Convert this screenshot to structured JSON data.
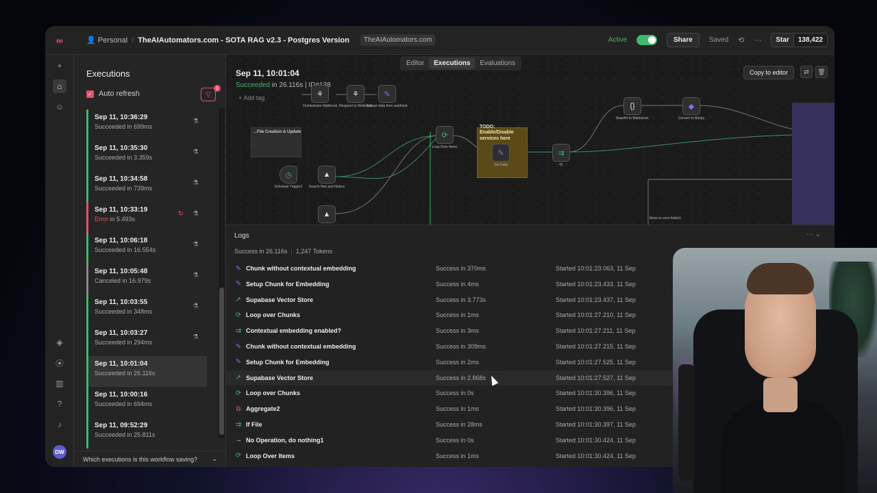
{
  "topbar": {
    "user": "Personal",
    "workflow_title": "TheAIAutomators.com - SOTA RAG v2.3 - Postgres Version",
    "tag": "TheAIAutomators.com",
    "active_label": "Active",
    "share_label": "Share",
    "saved_label": "Saved",
    "star_label": "Star",
    "star_count": "138,422"
  },
  "executions": {
    "title": "Executions",
    "auto_refresh_label": "Auto refresh",
    "filter_count": "1",
    "items": [
      {
        "date": "Sep 11, 10:36:29",
        "state": "Succeeded",
        "duration": "in 699ms",
        "kind": "ok"
      },
      {
        "date": "Sep 11, 10:35:30",
        "state": "Succeeded",
        "duration": "in 3.359s",
        "kind": "ok"
      },
      {
        "date": "Sep 11, 10:34:58",
        "state": "Succeeded",
        "duration": "in 739ms",
        "kind": "ok"
      },
      {
        "date": "Sep 11, 10:33:19",
        "state": "Error",
        "duration": "in 5.493s",
        "kind": "err"
      },
      {
        "date": "Sep 11, 10:06:18",
        "state": "Succeeded",
        "duration": "in 16.554s",
        "kind": "ok"
      },
      {
        "date": "Sep 11, 10:05:48",
        "state": "Canceled",
        "duration": "in 16.979s",
        "kind": "canc"
      },
      {
        "date": "Sep 11, 10:03:55",
        "state": "Succeeded",
        "duration": "in 348ms",
        "kind": "ok"
      },
      {
        "date": "Sep 11, 10:03:27",
        "state": "Succeeded",
        "duration": "in 294ms",
        "kind": "ok"
      },
      {
        "date": "Sep 11, 10:01:04",
        "state": "Succeeded",
        "duration": "in 26.116s",
        "kind": "ok"
      },
      {
        "date": "Sep 11, 10:00:16",
        "state": "Succeeded",
        "duration": "in 694ms",
        "kind": "ok"
      },
      {
        "date": "Sep 11, 09:52:29",
        "state": "Succeeded",
        "duration": "in 25.811s",
        "kind": "ok"
      }
    ],
    "footer": "Which executions is this workflow saving?"
  },
  "canvas": {
    "tabs": [
      "Editor",
      "Executions",
      "Evaluations"
    ],
    "active_tab": "Executions",
    "run_date": "Sep 11, 10:01:04",
    "run_state": "Succeeded",
    "run_detail": "in 26.116s | ID#138",
    "add_tag": "Add tag",
    "copy_label": "Copy to editor",
    "sticky_note": "TODO: Enable/Disable services here",
    "grey_note": "...File Creation & Update",
    "nodes": [
      {
        "label": "Orchestrator Webhook"
      },
      {
        "label": "Respond to Webhook"
      },
      {
        "label": "Extract data from webhook"
      },
      {
        "label": "Loop Over Items"
      },
      {
        "label": "Set Data"
      },
      {
        "label": "If1"
      },
      {
        "label": "Base64 to Markdown"
      },
      {
        "label": "Convert to Binary"
      },
      {
        "label": "Schedule Trigger1"
      },
      {
        "label": "Search files and folders"
      },
      {
        "label": "Move to error folder1"
      }
    ]
  },
  "logs": {
    "title": "Logs",
    "summary_status": "Success in 26.116s",
    "summary_tokens": "1,247 Tokens",
    "rows": [
      {
        "icon": "pencil-icon",
        "color": "purple",
        "name": "Chunk without contextual embedding",
        "status": "Success in 370ms",
        "started": "Started 10:01:23.063, 11 Sep"
      },
      {
        "icon": "pencil-icon",
        "color": "purple",
        "name": "Setup Chunk for Embedding",
        "status": "Success in 4ms",
        "started": "Started 10:01:23.433, 11 Sep"
      },
      {
        "icon": "bolt-icon",
        "color": "green",
        "name": "Supabase Vector Store",
        "status": "Success in 3.773s",
        "started": "Started 10:01:23.437, 11 Sep"
      },
      {
        "icon": "loop-icon",
        "color": "green",
        "name": "Loop over Chunks",
        "status": "Success in 1ms",
        "started": "Started 10:01:27.210, 11 Sep"
      },
      {
        "icon": "branch-icon",
        "color": "green",
        "name": "Contextual embedding enabled?",
        "status": "Success in 3ms",
        "started": "Started 10:01:27.211, 11 Sep"
      },
      {
        "icon": "pencil-icon",
        "color": "purple",
        "name": "Chunk without contextual embedding",
        "status": "Success in 309ms",
        "started": "Started 10:01:27.215, 11 Sep"
      },
      {
        "icon": "pencil-icon",
        "color": "purple",
        "name": "Setup Chunk for Embedding",
        "status": "Success in 2ms",
        "started": "Started 10:01:27.525, 11 Sep"
      },
      {
        "icon": "bolt-icon",
        "color": "green",
        "name": "Supabase Vector Store",
        "status": "Success in 2.868s",
        "started": "Started 10:01:27.527, 11 Sep"
      },
      {
        "icon": "loop-icon",
        "color": "green",
        "name": "Loop over Chunks",
        "status": "Success in 0s",
        "started": "Started 10:01:30.396, 11 Sep"
      },
      {
        "icon": "aggregate-icon",
        "color": "red",
        "name": "Aggregate2",
        "status": "Success in 1ms",
        "started": "Started 10:01:30.396, 11 Sep"
      },
      {
        "icon": "branch-icon",
        "color": "green",
        "name": "If File",
        "status": "Success in 28ms",
        "started": "Started 10:01:30.397, 11 Sep"
      },
      {
        "icon": "arrow-right-icon",
        "color": "white",
        "name": "No Operation, do nothing1",
        "status": "Success in 0s",
        "started": "Started 10:01:30.424, 11 Sep"
      },
      {
        "icon": "loop-icon",
        "color": "green",
        "name": "Loop Over Items",
        "status": "Success in 1ms",
        "started": "Started 10:01:30.424, 11 Sep"
      }
    ]
  },
  "colors": {
    "accent": "#e8506b",
    "success": "#3fb96b",
    "purple": "#8b6cf0"
  }
}
